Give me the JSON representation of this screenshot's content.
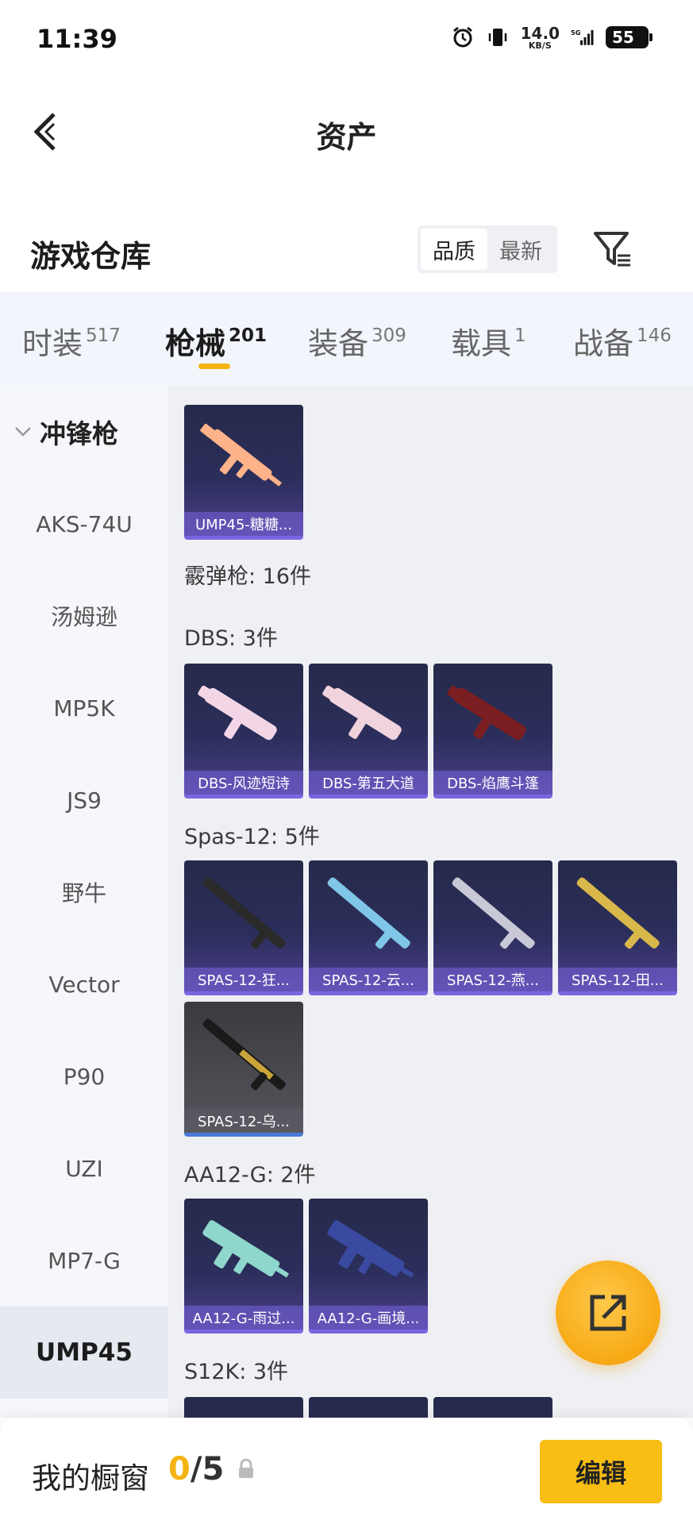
{
  "status_bar": {
    "time": "11:39",
    "net_speed_value": "14.0",
    "net_speed_unit": "KB/S",
    "battery": "55",
    "icons": [
      "alarm-icon",
      "vibrate-icon",
      "network-speed",
      "5g-signal-icon",
      "battery-icon"
    ]
  },
  "header": {
    "title": "资产",
    "back_icon": "back-arrow-icon"
  },
  "warehouse": {
    "title": "游戏仓库",
    "sort_options": [
      "品质",
      "最新"
    ],
    "selected_sort": "品质",
    "filter_icon": "filter-icon"
  },
  "tabs": [
    {
      "label": "时装",
      "count": "517"
    },
    {
      "label": "枪械",
      "count": "201",
      "active": true
    },
    {
      "label": "装备",
      "count": "309"
    },
    {
      "label": "载具",
      "count": "1"
    },
    {
      "label": "战备",
      "count": "146"
    }
  ],
  "sidebar": {
    "group": "冲锋枪",
    "items": [
      "AKS-74U",
      "汤姆逊",
      "MP5K",
      "JS9",
      "野牛",
      "Vector",
      "P90",
      "UZI",
      "MP7-G",
      "UMP45"
    ],
    "selected": "UMP45"
  },
  "content": {
    "top_card": {
      "name": "UMP45-糖糖...",
      "color": "#ffb38a"
    },
    "shotgun_header": "霰弹枪: 16件",
    "sections": [
      {
        "title": "DBS: 3件",
        "items": [
          {
            "name": "DBS-风迹短诗",
            "color": "#f3d6e6"
          },
          {
            "name": "DBS-第五大道",
            "color": "#f1d3de"
          },
          {
            "name": "DBS-焰鹰斗篷",
            "color": "#7a1e22"
          }
        ]
      },
      {
        "title": "Spas-12: 5件",
        "items": [
          {
            "name": "SPAS-12-狂...",
            "color": "#2a2a2a"
          },
          {
            "name": "SPAS-12-云...",
            "color": "#7fc6e8"
          },
          {
            "name": "SPAS-12-燕...",
            "color": "#c8c8d6"
          },
          {
            "name": "SPAS-12-田...",
            "color": "#d8b84a"
          },
          {
            "name": "SPAS-12-乌...",
            "color": "#1a1a1a",
            "gray": true
          }
        ]
      },
      {
        "title": "AA12-G: 2件",
        "items": [
          {
            "name": "AA12-G-雨过...",
            "color": "#8fd6cc"
          },
          {
            "name": "AA12-G-画境...",
            "color": "#3a4aa0"
          }
        ]
      },
      {
        "title": "S12K: 3件",
        "items": []
      }
    ]
  },
  "share_icon": "share-external-icon",
  "bottom_bar": {
    "label": "我的橱窗",
    "current": "0",
    "separator": "/",
    "max": "5",
    "lock_icon": "lock-icon",
    "edit_label": "编辑"
  },
  "colors": {
    "accent": "#f3b413",
    "edit_button": "#f8be14",
    "card_bottom": "#7a66e0"
  }
}
